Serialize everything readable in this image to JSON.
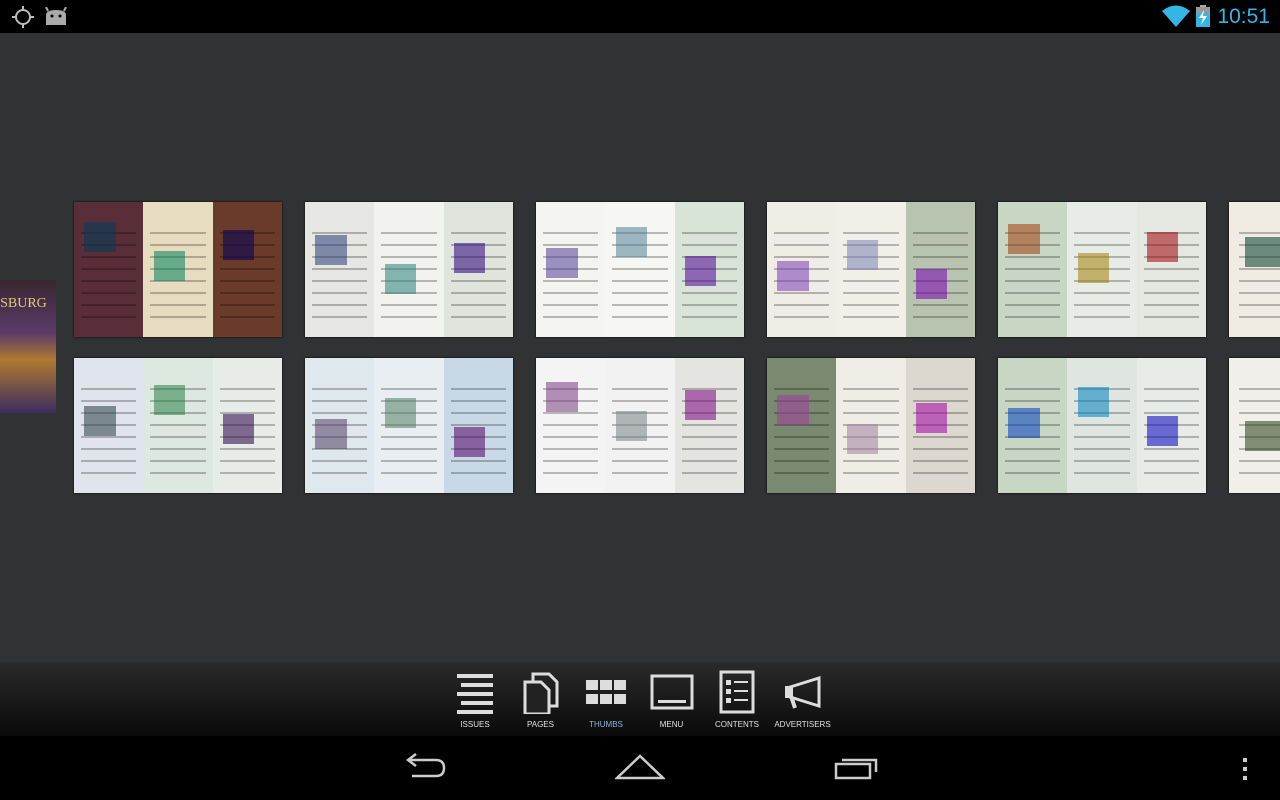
{
  "status_bar": {
    "time": "10:51",
    "left_icons": [
      "gps-icon",
      "android-debug-icon"
    ],
    "right_icons": [
      "wifi-icon",
      "battery-charging-icon"
    ],
    "accent": "#33b5e5"
  },
  "cover": {
    "text": "YSBURG"
  },
  "thumbnails": [
    {
      "colors": [
        "#5a2e38",
        "#e8dcc0",
        "#6a3a2a"
      ]
    },
    {
      "colors": [
        "#e6e6e2",
        "#f2f2ee",
        "#dfe4dc"
      ]
    },
    {
      "colors": [
        "#f4f4f0",
        "#f6f6f2",
        "#d8e4d8"
      ]
    },
    {
      "colors": [
        "#f0ece6",
        "#f2efe8",
        "#b8c4b0"
      ]
    },
    {
      "colors": [
        "#c8d6c4",
        "#e8ece6",
        "#e4e8e0"
      ]
    },
    {
      "colors": [
        "#f0ece4",
        "#a04020"
      ]
    },
    {
      "colors": [
        "#e0e4ec",
        "#dde8e0",
        "#e8ece8"
      ]
    },
    {
      "colors": [
        "#dfe8ec",
        "#e8eef2",
        "#c8d8e6"
      ]
    },
    {
      "colors": [
        "#f4f4f4",
        "#f2f2f2",
        "#e4e4e0"
      ]
    },
    {
      "colors": [
        "#7a8a70",
        "#f0ece6",
        "#dcd8d0"
      ]
    },
    {
      "colors": [
        "#c8d6c4",
        "#dfe6e2",
        "#e8ece8"
      ]
    },
    {
      "colors": [
        "#f0efea",
        "#e8e8e4"
      ]
    }
  ],
  "toolbar": {
    "items": [
      {
        "label": "ISSUES",
        "icon": "list-icon"
      },
      {
        "label": "PAGES",
        "icon": "pages-icon"
      },
      {
        "label": "THUMBS",
        "icon": "grid-icon",
        "active": true
      },
      {
        "label": "MENU",
        "icon": "menu-icon"
      },
      {
        "label": "CONTENTS",
        "icon": "contents-icon"
      },
      {
        "label": "ADVERTISERS",
        "icon": "megaphone-icon"
      }
    ],
    "active_color": "#8fb3d9"
  },
  "nav_bar": {
    "icons": [
      "back-icon",
      "home-icon",
      "recents-icon",
      "overflow-menu-icon"
    ]
  }
}
